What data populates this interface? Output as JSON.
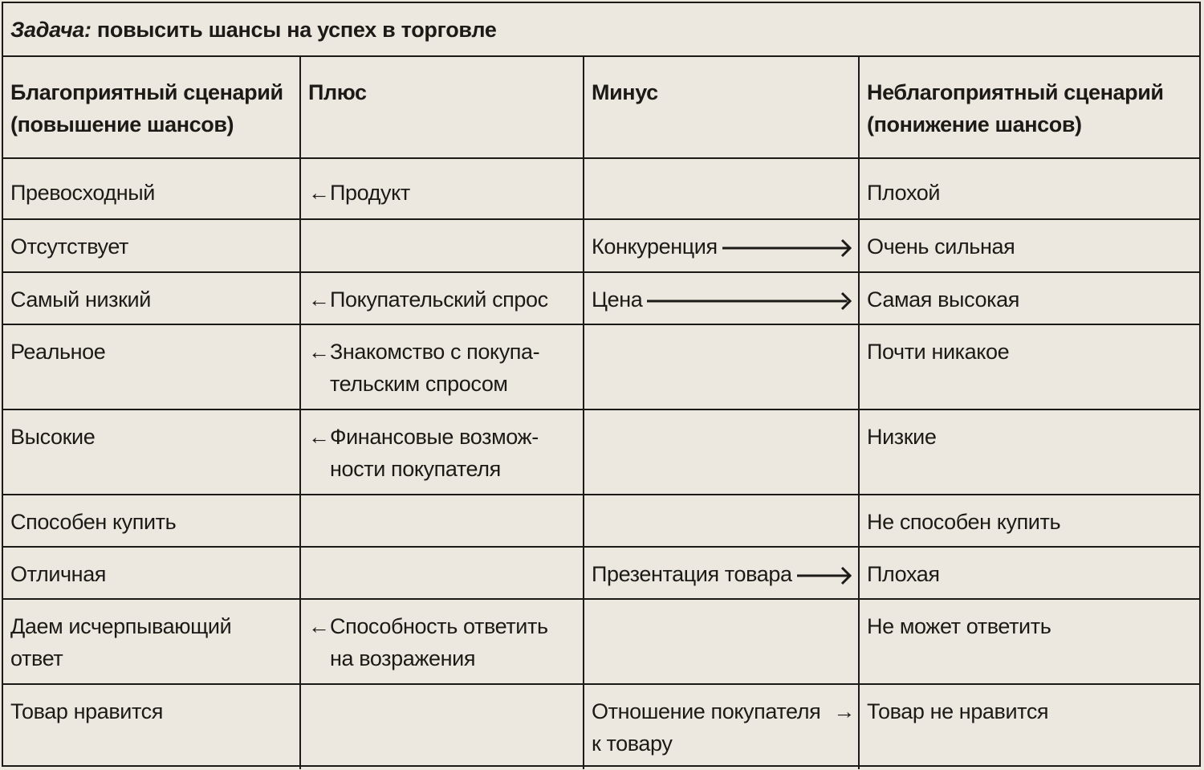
{
  "title": {
    "prefix": "Задача:",
    "text": "повысить шансы на успех в торговле"
  },
  "headers": {
    "favorable_line1": "Благоприятный сценарий",
    "favorable_line2": "(повышение шансов)",
    "plus": "Плюс",
    "minus": "Минус",
    "unfavorable_line1": "Неблагоприятный сценарий",
    "unfavorable_line2": "(понижение шансов)"
  },
  "arrow_left_glyph": "←",
  "arrow_right_glyph": "→",
  "rows": [
    {
      "favorable": "Превосходный",
      "plus": "Продукт",
      "minus": "",
      "unfavorable": "Плохой"
    },
    {
      "favorable": "Отсутствует",
      "plus": "",
      "minus": "Конкуренция",
      "unfavorable": "Очень сильная"
    },
    {
      "favorable": "Самый низкий",
      "plus": "Покупательский спрос",
      "minus": "Цена",
      "unfavorable": "Самая высокая"
    },
    {
      "favorable": "Реальное",
      "plus_line1": "Знакомство с покупа-",
      "plus_line2": "тельским спросом",
      "minus": "",
      "unfavorable": "Почти никакое"
    },
    {
      "favorable": "Высокие",
      "plus_line1": "Финансовые возмож-",
      "plus_line2": "ности покупателя",
      "minus": "",
      "unfavorable": "Низкие"
    },
    {
      "favorable": "Способен купить",
      "plus": "",
      "minus": "",
      "unfavorable": "Не способен купить"
    },
    {
      "favorable": "Отличная",
      "plus": "",
      "minus": "Презентация товара",
      "unfavorable": "Плохая"
    },
    {
      "favorable_line1": "Даем исчерпывающий",
      "favorable_line2": "ответ",
      "plus_line1": "Способность ответить",
      "plus_line2": "на возражения",
      "minus": "",
      "unfavorable": "Не может ответить"
    },
    {
      "favorable": "Товар нравится",
      "plus": "",
      "minus_line1": "Отношение покупателя",
      "minus_line2": "к товару",
      "unfavorable": "Товар не нравится"
    }
  ]
}
